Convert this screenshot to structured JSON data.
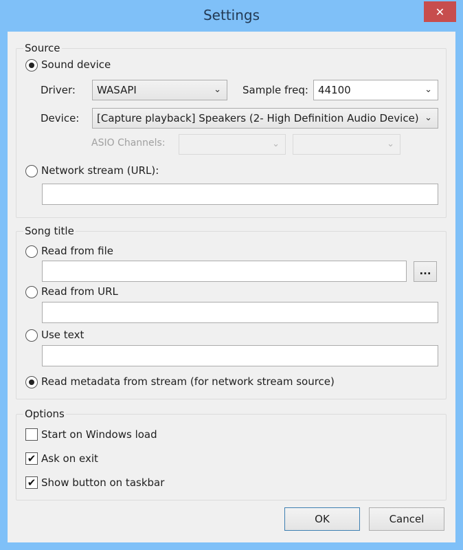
{
  "window": {
    "title": "Settings",
    "close_label": "✕"
  },
  "source": {
    "group_label": "Source",
    "sound_device": {
      "label": "Sound device",
      "checked": true
    },
    "driver": {
      "label": "Driver:",
      "value": "WASAPI"
    },
    "sample_freq": {
      "label": "Sample freq:",
      "value": "44100"
    },
    "device": {
      "label": "Device:",
      "value": "[Capture playback] Speakers (2- High Definition Audio Device)"
    },
    "asio": {
      "label": "ASIO Channels:",
      "left_value": "",
      "right_value": ""
    },
    "network_stream": {
      "label": "Network stream (URL):",
      "checked": false,
      "value": ""
    }
  },
  "song_title": {
    "group_label": "Song title",
    "read_from_file": {
      "label": "Read from file",
      "checked": false,
      "value": ""
    },
    "browse_label": "...",
    "read_from_url": {
      "label": "Read from URL",
      "checked": false,
      "value": ""
    },
    "use_text": {
      "label": "Use text",
      "checked": false,
      "value": ""
    },
    "read_metadata": {
      "label": "Read metadata from stream (for network stream source)",
      "checked": true
    }
  },
  "options": {
    "group_label": "Options",
    "items": [
      {
        "label": "Start on Windows load",
        "checked": false
      },
      {
        "label": "Ask on exit",
        "checked": true
      },
      {
        "label": "Show button on taskbar",
        "checked": true
      }
    ],
    "check_glyph": "✔"
  },
  "buttons": {
    "ok": "OK",
    "cancel": "Cancel"
  },
  "icons": {
    "chevron": "⌄"
  }
}
